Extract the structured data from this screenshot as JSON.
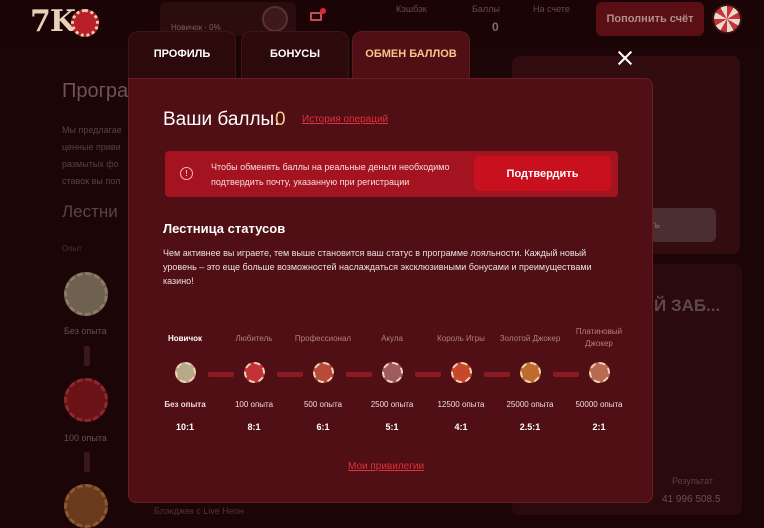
{
  "header": {
    "logo_text": "7K",
    "user_rank": "Новичок · 0%",
    "balance_label": "Кэшбэк",
    "points_label": "Баллы",
    "points_value": "0",
    "account_label": "На счете",
    "topup_label": "Пополнить счёт"
  },
  "background": {
    "title": "Програм",
    "text_lines": [
      "Мы предлагае",
      "ценные приви",
      "размытых фо",
      "ставок вы пол"
    ],
    "ladder_title": "Лестни",
    "exp_label": "Опыт",
    "chip1_label": "Без опыта",
    "chip2_label": "100 опыта",
    "right_button": "ть",
    "promo_text": "Й ЗАБ...",
    "result_label": "Результат",
    "amount": "41 996 508.5",
    "bottom_text": "Блэкджек с Live Неон"
  },
  "tabs": [
    {
      "label": "ПРОФИЛЬ",
      "active": false
    },
    {
      "label": "БОНУСЫ",
      "active": false
    },
    {
      "label": "ОБМЕН БАЛЛОВ",
      "active": true
    }
  ],
  "modal": {
    "balance_label": "Ваши баллы:",
    "balance_value": "0",
    "history_link": "История операций",
    "alert_text": "Чтобы обменять баллы на реальные деньги необходимо подтвердить почту, указанную при регистрации",
    "confirm_button": "Подтвердить",
    "ladder_title": "Лестница статусов",
    "ladder_description": "Чем активнее вы играете, тем выше становится ваш статус в программе лояльности. Каждый новый уровень – это еще больше возможностей наслаждаться эксклюзивными бонусами и преимуществами казино!",
    "privileges_link": "Мои привилегии"
  },
  "ranks": [
    {
      "name": "Новичок",
      "exp": "Без опыта",
      "ratio": "10:1",
      "current": true,
      "chip_color": "#b9a98a"
    },
    {
      "name": "Любитель",
      "exp": "100 опыта",
      "ratio": "8:1",
      "current": false,
      "chip_color": "#c23238"
    },
    {
      "name": "Профессионал",
      "exp": "500 опыта",
      "ratio": "6:1",
      "current": false,
      "chip_color": "#b84a3a"
    },
    {
      "name": "Акула",
      "exp": "2500 опыта",
      "ratio": "5:1",
      "current": false,
      "chip_color": "#9e5a5e"
    },
    {
      "name": "Король Игры",
      "exp": "12500 опыта",
      "ratio": "4:1",
      "current": false,
      "chip_color": "#c8462a"
    },
    {
      "name": "Золотой Джокер",
      "exp": "25000 опыта",
      "ratio": "2.5:1",
      "current": false,
      "chip_color": "#c06a30"
    },
    {
      "name": "Платиновый Джокер",
      "exp": "50000 опыта",
      "ratio": "2:1",
      "current": false,
      "chip_color": "#b86a52"
    }
  ]
}
